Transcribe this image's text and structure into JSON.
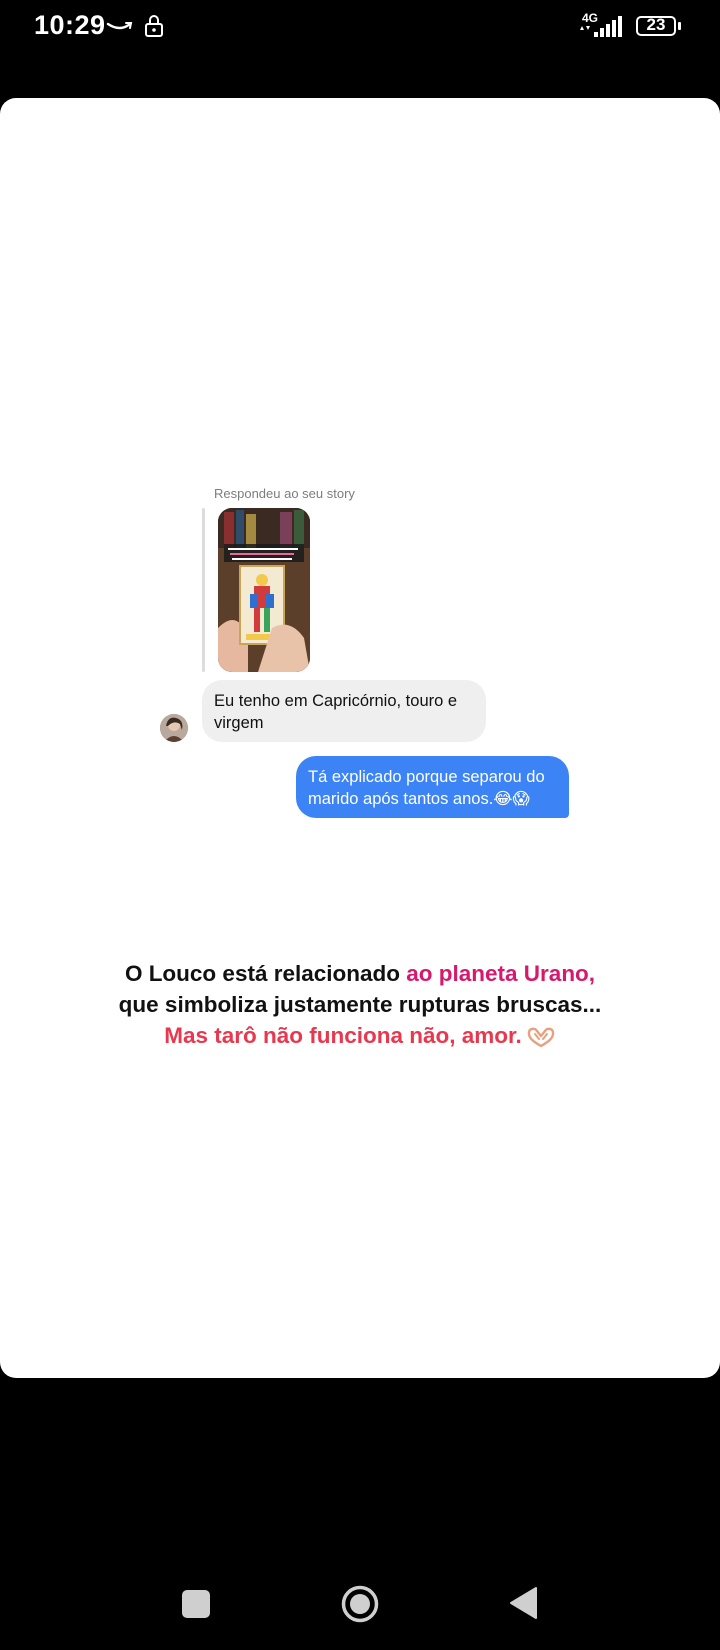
{
  "status_bar": {
    "time": "10:29",
    "network": "4G",
    "battery": "23",
    "icons": [
      "amazon-smile-icon",
      "lock-icon",
      "signal-icon",
      "battery-icon"
    ]
  },
  "chat": {
    "replied_label": "Respondeu ao seu story",
    "story": {
      "icon": "story-thumbnail-tarot-card"
    },
    "incoming_message": "Eu tenho em Capricórnio,  touro e virgem",
    "outgoing_message": "Tá explicado porque separou do marido após tantos anos.",
    "outgoing_emojis": "😂😱"
  },
  "caption": {
    "line1_start": "O Louco está relacionado ",
    "line1_highlight": "ao planeta Urano,",
    "line2": "que simboliza justamente rupturas bruscas...",
    "line3": "Mas tarô não funciona não, amor."
  },
  "nav_bar": {
    "items": [
      "recent-apps-button",
      "home-button",
      "back-button"
    ]
  },
  "colors": {
    "magenta": "#d6196c",
    "red": "#e8384f",
    "outgoing_bubble": "#3c83f5",
    "incoming_bubble": "#efefef"
  }
}
